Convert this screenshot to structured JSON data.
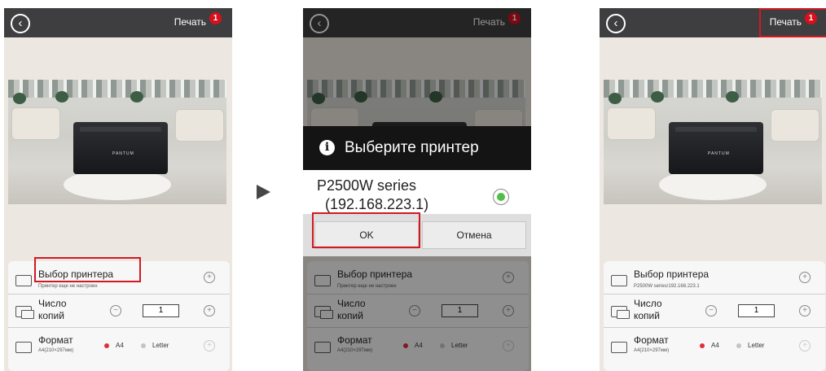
{
  "header": {
    "title": "Печать",
    "badge": "1"
  },
  "printer_logo": "PANTUM",
  "rows": {
    "select_printer": {
      "label": "Выбор принтера",
      "sub_empty": "Принтер еще не настроен",
      "sub_set": "P2500W series/192.168.223.1"
    },
    "copies": {
      "label_line1": "Число",
      "label_line2": "копий",
      "value": "1"
    },
    "format": {
      "label": "Формат",
      "sub": "A4(210×297мм)",
      "option_a4": "A4",
      "option_letter": "Letter"
    }
  },
  "dialog": {
    "title": "Выберите принтер",
    "printer_name": "P2500W series",
    "printer_ip": "(192.168.223.1)",
    "ok": "OK",
    "cancel": "Отмена"
  },
  "colors": {
    "highlight": "#d41823",
    "badge": "#d80f1c",
    "radio_selected": "#e02c3c",
    "connected": "#4fbf45"
  },
  "icons": [
    "back-icon",
    "printer-icon",
    "copies-icon",
    "paper-icon",
    "plus-icon",
    "minus-icon",
    "info-icon",
    "next-step-arrow-icon"
  ]
}
